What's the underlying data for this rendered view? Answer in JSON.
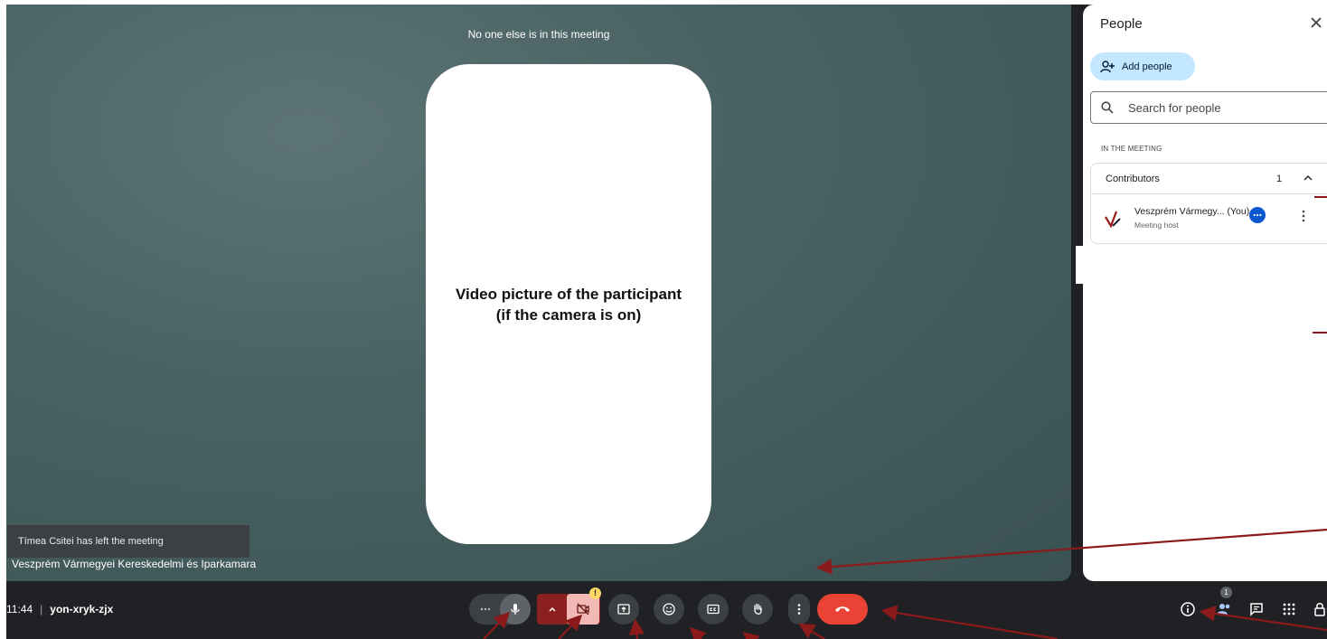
{
  "stage": {
    "notice": "No one else is in this meeting",
    "video_placeholder": "Video picture of the participant\n(if the camera is on)",
    "toast": "Tímea Csitei has left the meeting",
    "participant_label": "Veszprém Vármegyei Kereskedelmi és Iparkamara"
  },
  "people_panel": {
    "title": "People",
    "add_people_label": "Add people",
    "search_placeholder": "Search for people",
    "section_label": "IN THE MEETING",
    "group": {
      "title": "Contributors",
      "count": "1",
      "person": {
        "name": "Veszprém Vármegy... (You)",
        "role": "Meeting host"
      }
    }
  },
  "bottom_bar": {
    "time": "11:44",
    "meeting_code": "yon-xryk-zjx",
    "camera_warning": "!",
    "people_count": "1"
  },
  "colors": {
    "accent": "#c2e7ff",
    "end_call": "#ea4335",
    "annotation": "#8b1a1a",
    "camera_off": "#f2b8b5"
  }
}
